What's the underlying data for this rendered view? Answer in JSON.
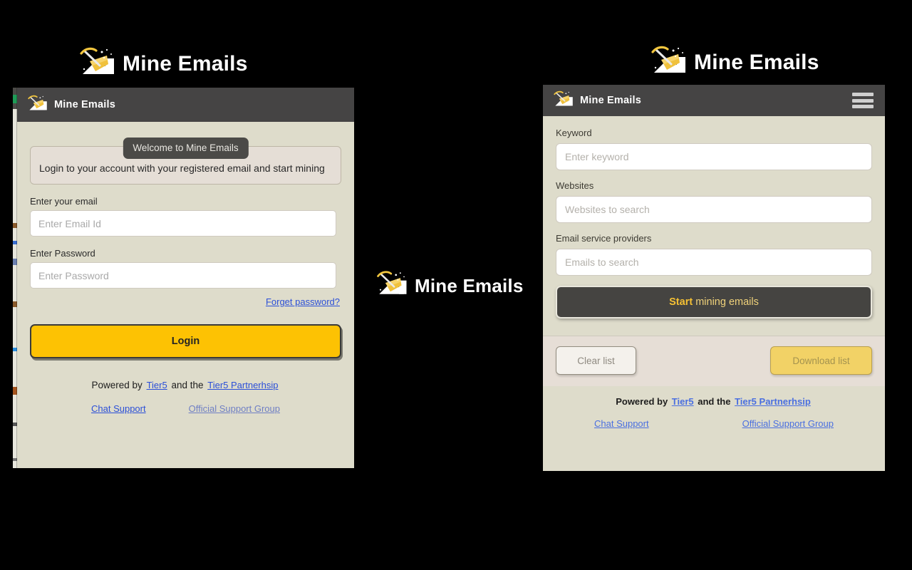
{
  "brand": {
    "name": "Mine Emails",
    "logo_icon": "pickaxe-gold-pile-icon",
    "accent_yellow": "#fdc203",
    "panel_bg": "#dedccb",
    "header_bg": "#454444",
    "link_blue": "#2b4fd8"
  },
  "hero": {
    "left_title": "Mine Emails",
    "center_title": "Mine Emails",
    "right_title": "Mine Emails"
  },
  "login_panel": {
    "header_title": "Mine Emails",
    "welcome_badge": "Welcome to Mine Emails",
    "welcome_text": "Login to your account with your registered email and start mining",
    "email_label": "Enter your email",
    "email_placeholder": "Enter Email Id",
    "email_value": "",
    "password_label": "Enter Password",
    "password_placeholder": "Enter Password",
    "password_value": "",
    "forgot_label": "Forget password?",
    "login_button": "Login"
  },
  "miner_panel": {
    "header_title": "Mine Emails",
    "menu_icon": "hamburger-menu-icon",
    "keyword_label": "Keyword",
    "keyword_placeholder": "Enter keyword",
    "keyword_value": "",
    "websites_label": "Websites",
    "websites_placeholder": "Websites to search",
    "websites_value": "",
    "providers_label": "Email service providers",
    "providers_placeholder": "Emails to search",
    "providers_value": "",
    "mine_button_strong": "Start",
    "mine_button_rest": " mining emails",
    "clear_button": "Clear list",
    "download_button": "Download list"
  },
  "footer": {
    "powered_prefix": "Powered by ",
    "powered_link1": "Tier5",
    "powered_middle": " and the ",
    "powered_link2": "Tier5 Partnerhsip",
    "chat_support": "Chat Support",
    "official_group": "Official Support Group"
  }
}
